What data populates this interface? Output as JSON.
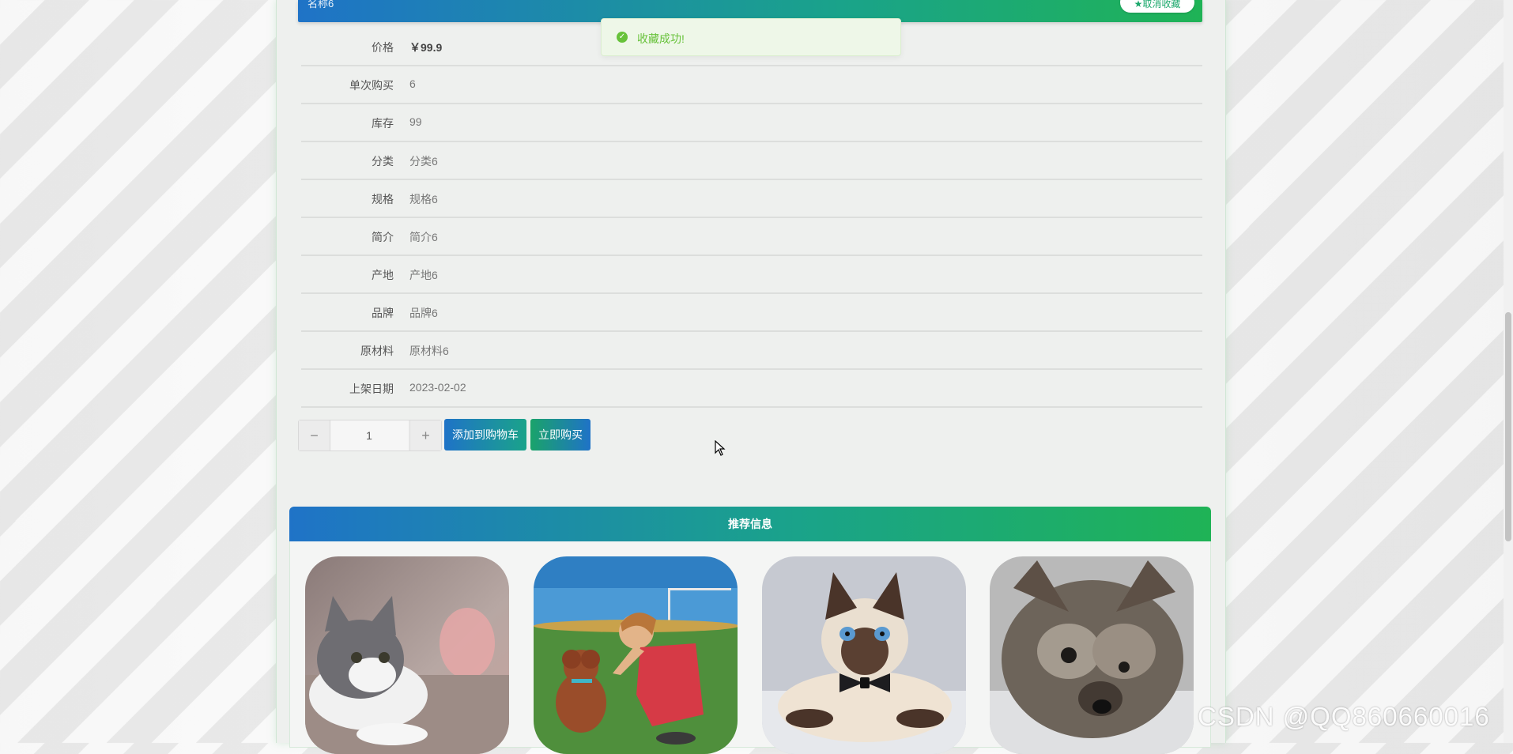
{
  "header": {
    "title": "名称6",
    "favorite_button": "★取消收藏"
  },
  "toast": {
    "icon": "check-circle-icon",
    "message": "收藏成功!"
  },
  "details": [
    {
      "label": "价格",
      "value": "￥99.9"
    },
    {
      "label": "单次购买",
      "value": "6"
    },
    {
      "label": "库存",
      "value": "99"
    },
    {
      "label": "分类",
      "value": "分类6"
    },
    {
      "label": "规格",
      "value": "规格6"
    },
    {
      "label": "简介",
      "value": "简介6"
    },
    {
      "label": "产地",
      "value": "产地6"
    },
    {
      "label": "品牌",
      "value": "品牌6"
    },
    {
      "label": "原材料",
      "value": "原材料6"
    },
    {
      "label": "上架日期",
      "value": "2023-02-02"
    }
  ],
  "quantity": {
    "minus": "−",
    "value": "1",
    "plus": "+"
  },
  "actions": {
    "add_to_cart": "添加到购物车",
    "buy_now": "立即购买"
  },
  "recommend": {
    "title": "推荐信息",
    "items": [
      "grey-white-cat-photo",
      "girl-with-poodle-photo",
      "siamese-cat-bowtie-photo",
      "yorkie-puppy-photo"
    ]
  },
  "watermark": "CSDN @QQ860660016",
  "colors": {
    "accent_blue": "#1f73c7",
    "accent_green": "#1fb356",
    "success": "#67c23a"
  }
}
